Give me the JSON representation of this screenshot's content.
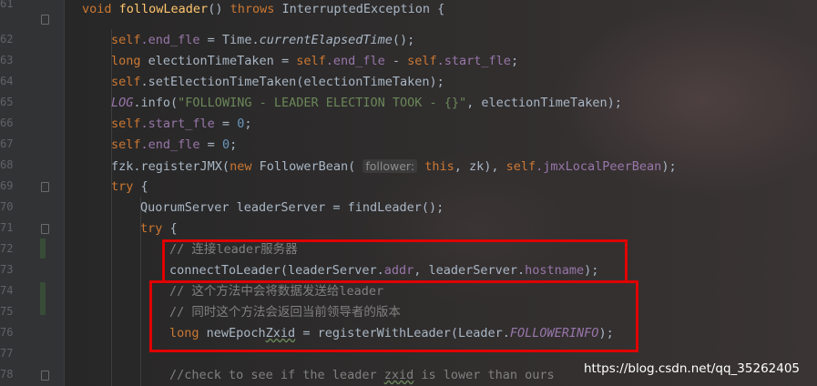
{
  "line_numbers": [
    "61",
    "62",
    "63",
    "64",
    "65",
    "66",
    "67",
    "68",
    "69",
    "70",
    "71",
    "72",
    "73",
    "74",
    "75",
    "76",
    "77",
    "78"
  ],
  "code": {
    "l61": {
      "kw_void": "void",
      "method_name": "followLeader",
      "parens": "() ",
      "kw_throws": "throws",
      "exception": " InterruptedException {"
    },
    "l62": {
      "self": "self",
      "field_end": ".end_fle",
      "assign": " = Time.",
      "method": "currentElapsedTime",
      "tail": "();"
    },
    "l63": {
      "kw_long": "long",
      "decl": " electionTimeTaken = ",
      "self1": "self",
      "field_end": ".end_fle",
      "minus": " - ",
      "self2": "self",
      "field_start": ".start_fle",
      "semi": ";"
    },
    "l64": {
      "self": "self",
      "call": ".setElectionTimeTaken(electionTimeTaken);"
    },
    "l65": {
      "log": "LOG",
      "info": ".info(",
      "str": "\"FOLLOWING - LEADER ELECTION TOOK - {}\"",
      "tail": ", electionTimeTaken);"
    },
    "l66": {
      "self": "self",
      "field": ".start_fle",
      "assign": " = ",
      "num": "0",
      "semi": ";"
    },
    "l67": {
      "self": "self",
      "field": ".end_fle",
      "assign": " = ",
      "num": "0",
      "semi": ";"
    },
    "l68": {
      "fzk": "fzk",
      "call1": ".registerJMX(",
      "kw_new": "new",
      "call2": " FollowerBean( ",
      "hint": "follower:",
      "kw_this": "this",
      "mid": ", zk), ",
      "self": "self",
      "field": ".jmxLocalPeerBean",
      "tail": ");"
    },
    "l69": {
      "kw_try": "try",
      "brace": " {"
    },
    "l70": {
      "text": "QuorumServer leaderServer = findLeader();"
    },
    "l71": {
      "kw_try": "try",
      "brace": " {"
    },
    "l72": {
      "comment": "// 连接leader服务器"
    },
    "l73": {
      "pre": "connectToLeader(leaderServer.",
      "f_addr": "addr",
      "mid": ", leaderServer.",
      "f_host": "hostname",
      "tail": ");"
    },
    "l74": {
      "comment": "// 这个方法中会将数据发送给leader"
    },
    "l75": {
      "comment": "// 同时这个方法会返回当前领导者的版本"
    },
    "l76": {
      "kw_long": "long",
      "pre": " newEpoch",
      "wavy": "Zxid",
      "mid": " = registerWithLeader(Leader.",
      "const": "FOLLOWERINFO",
      "tail": ");"
    },
    "l78": {
      "pre": "//check to see if the leader ",
      "wavy": "zxid",
      "tail": " is lower than ours"
    }
  },
  "watermark": "https://blog.csdn.net/qq_35262405",
  "icons": [
    "fold-marker-icon"
  ],
  "colors": {
    "background": "#2b2b2b",
    "keyword": "#cc7832",
    "method": "#ffc66d",
    "field": "#9876aa",
    "string": "#6a8759",
    "number": "#6897bb",
    "comment": "#808080",
    "highlight_box": "#e00000"
  }
}
